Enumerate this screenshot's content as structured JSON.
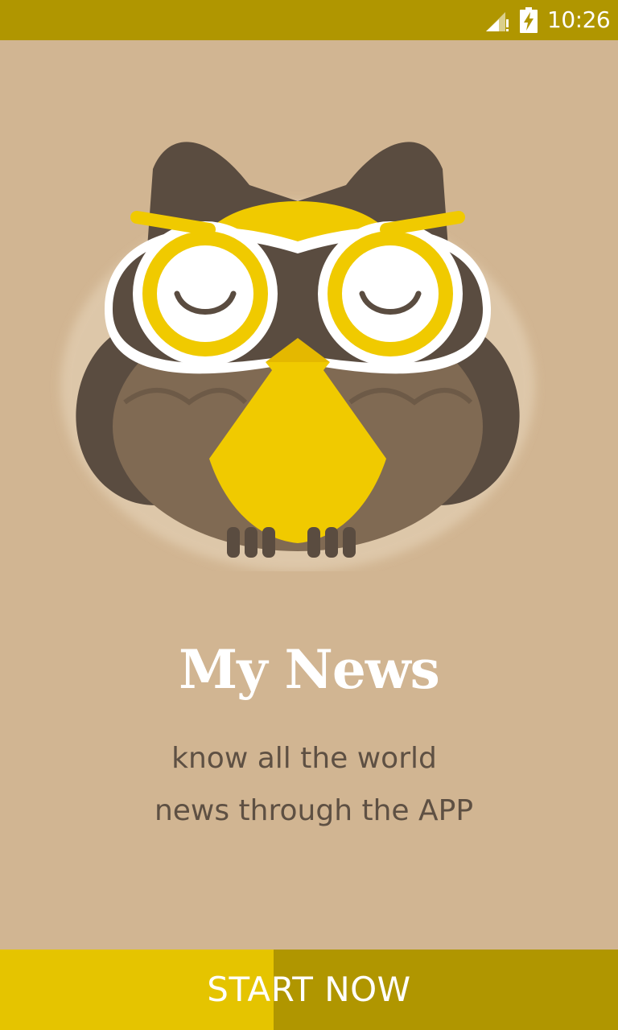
{
  "status_bar": {
    "time": "10:26",
    "icons": [
      "signal-icon",
      "battery-charging-icon"
    ]
  },
  "app": {
    "title": "My News",
    "tagline_line1": "know all the world",
    "tagline_line2": "news through the APP",
    "logo_icon": "owl-logo"
  },
  "cta": {
    "label": "START NOW"
  },
  "colors": {
    "background": "#d1b592",
    "status_bar": "#b09600",
    "accent_yellow": "#e5c400",
    "owl_brown_dark": "#5a4c40",
    "owl_brown_light": "#806a53",
    "owl_yellow": "#f0ca00",
    "tagline_text": "#5e5043"
  }
}
